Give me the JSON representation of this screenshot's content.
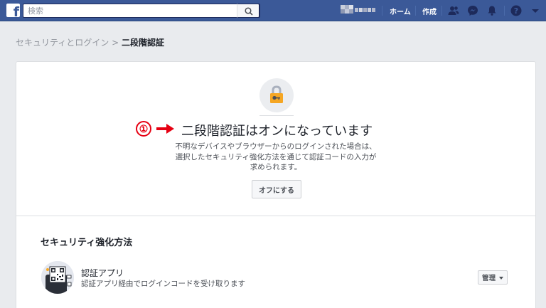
{
  "topbar": {
    "logo_letter": "f",
    "search_placeholder": "検索",
    "nav": {
      "home": "ホーム",
      "create": "作成"
    },
    "icons": [
      "friends-icon",
      "messenger-icon",
      "notifications-icon",
      "help-icon",
      "account-menu-icon"
    ]
  },
  "breadcrumb": {
    "parent": "セキュリティとログイン",
    "separator": " > ",
    "current": "二段階認証"
  },
  "status": {
    "callout_number": "①",
    "heading": "二段階認証はオンになっています",
    "description": "不明なデバイスやブラウザーからのログインされた場合は、選択したセキュリティ強化方法を通じて認証コードの入力が求められます。",
    "turn_off_label": "オフにする"
  },
  "methods": {
    "title": "セキュリティ強化方法",
    "items": [
      {
        "title": "認証アプリ",
        "subtitle": "認証アプリ経由でログインコードを受け取ります",
        "manage_label": "管理"
      }
    ]
  },
  "colors": {
    "brand": "#3b5998",
    "callout": "#e60012",
    "lock": "#f5a623"
  }
}
